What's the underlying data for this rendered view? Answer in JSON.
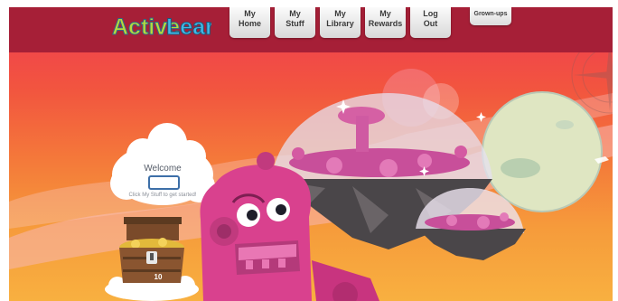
{
  "logo": {
    "text_part1": "Active",
    "text_part2": "Learn"
  },
  "nav": [
    {
      "line1": "My",
      "line2": "Home"
    },
    {
      "line1": "My",
      "line2": "Stuff"
    },
    {
      "line1": "My",
      "line2": "Library"
    },
    {
      "line1": "My",
      "line2": "Rewards"
    },
    {
      "line1": "Log",
      "line2": "Out"
    }
  ],
  "grownups_label": "Grown-ups",
  "welcome": {
    "title": "Welcome",
    "input_value": "",
    "hint": "Click My Stuff to get started!"
  },
  "chest": {
    "count": "10"
  },
  "colors": {
    "topbar": "#a61f37",
    "sky_top": "#ef3a52",
    "sky_bottom": "#f8b040",
    "robot_pink": "#d9418e",
    "input_border": "#3d6fa8"
  },
  "icons": [
    "treasure-chest-icon",
    "welcome-cloud-icon",
    "robot-mascot-icon",
    "planet-icon"
  ]
}
